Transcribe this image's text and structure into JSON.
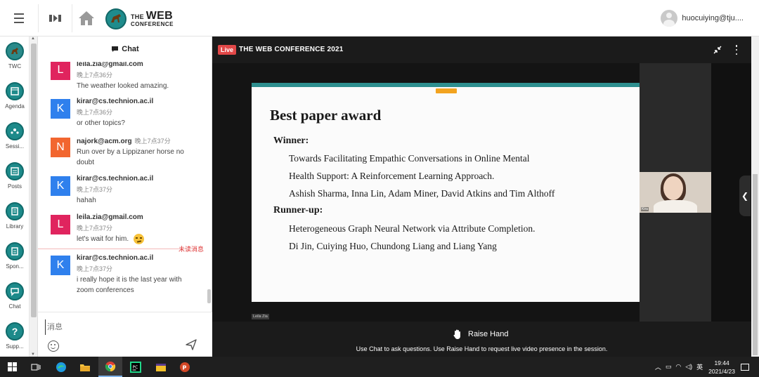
{
  "header": {
    "menu_icon": "hamburger-icon",
    "zoom_icon": "zoom-icon",
    "home_icon": "home-icon",
    "logo": {
      "line1_prefix": "THE",
      "line1_main": "WEB",
      "line2": "CONFERENCE"
    },
    "user_name": "huocuiying@tju...."
  },
  "nav": {
    "items": [
      {
        "label": "TWC",
        "icon": "twc-logo-icon"
      },
      {
        "label": "Agenda",
        "icon": "agenda-icon"
      },
      {
        "label": "Sessi...",
        "icon": "sessions-icon"
      },
      {
        "label": "Posts",
        "icon": "posts-icon"
      },
      {
        "label": "Library",
        "icon": "library-icon"
      },
      {
        "label": "Spon...",
        "icon": "sponsors-icon"
      },
      {
        "label": "Chat",
        "icon": "chat-icon"
      },
      {
        "label": "Supp...",
        "icon": "support-icon",
        "glyph": "?"
      }
    ]
  },
  "chat": {
    "title": "Chat",
    "messages": [
      {
        "initial": "L",
        "color": "#e0245e",
        "sender": "leila.zia@gmail.com",
        "time": "晚上7点36分",
        "text": "The weather looked amazing."
      },
      {
        "initial": "K",
        "color": "#2f80ed",
        "sender": "kirar@cs.technion.ac.il",
        "time": "晚上7点36分",
        "text": "or other topics?"
      },
      {
        "initial": "N",
        "color": "#f2662f",
        "sender": "najork@acm.org",
        "time": "晚上7点37分",
        "text": "Run over by a Lippizaner horse no doubt"
      },
      {
        "initial": "K",
        "color": "#2f80ed",
        "sender": "kirar@cs.technion.ac.il",
        "time": "晚上7点37分",
        "text": "hahah"
      },
      {
        "initial": "L",
        "color": "#e0245e",
        "sender": "leila.zia@gmail.com",
        "time": "晚上7点37分",
        "text": "let's wait for him."
      },
      {
        "initial": "K",
        "color": "#2f80ed",
        "sender": "kirar@cs.technion.ac.il",
        "time": "晚上7点37分",
        "text": "i really hope it is the last year with zoom conferences"
      }
    ],
    "unread_label": "未读消息",
    "input_placeholder": "消息"
  },
  "stage": {
    "live_label": "Live",
    "title": "THE WEB CONFERENCE 2021",
    "raise_hand_label": "Raise Hand",
    "help_text": "Use Chat to ask questions. Use Raise Hand to request live video presence in the session.",
    "presenter_tag": "Leila Zia",
    "speaker_tag": "Kira"
  },
  "slide": {
    "title": "Best paper award",
    "winner_label": "Winner:",
    "winner_lines": [
      "Towards Facilitating Empathic Conversations in Online Mental",
      "Health Support: A Reinforcement Learning Approach.",
      "Ashish Sharma, Inna Lin, Adam Miner, David Atkins and Tim Althoff"
    ],
    "runner_label": "Runner-up:",
    "runner_lines": [
      "Heterogeneous Graph Neural Network via Attribute Completion.",
      "Di Jin, Cuiying Huo, Chundong Liang and Liang Yang"
    ]
  },
  "taskbar": {
    "apps": [
      "start-icon",
      "task-view-icon",
      "edge-icon",
      "file-explorer-icon",
      "chrome-icon",
      "pycharm-icon",
      "winrar-icon",
      "powerpoint-icon"
    ],
    "ime": "英",
    "time": "19:44",
    "date": "2021/4/23"
  },
  "colors": {
    "accent": "#1d8a8a",
    "live": "#e24848",
    "stage_bg": "#1b1b1b"
  }
}
